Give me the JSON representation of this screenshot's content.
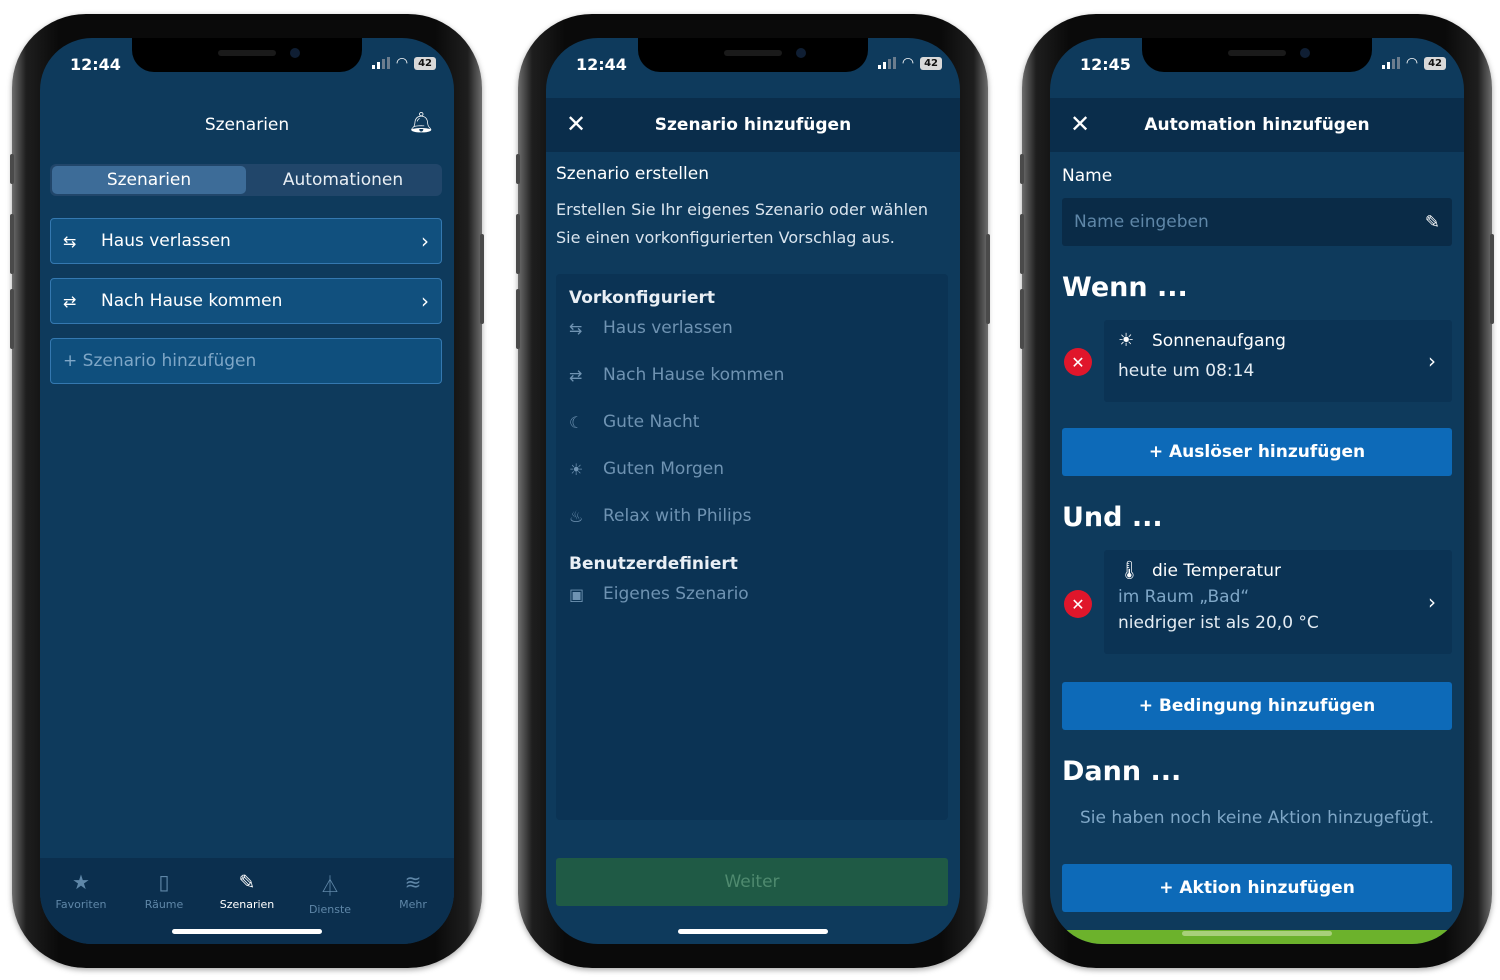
{
  "phone1": {
    "time": "12:44",
    "battery": "42",
    "title": "Szenarien",
    "segments": [
      "Szenarien",
      "Automationen"
    ],
    "rows": [
      {
        "label": "Haus verlassen",
        "icon": "leave-home-icon"
      },
      {
        "label": "Nach Hause kommen",
        "icon": "come-home-icon"
      }
    ],
    "add_label": "+ Szenario hinzufügen",
    "tabs": [
      {
        "label": "Favoriten",
        "icon": "star-icon"
      },
      {
        "label": "Räume",
        "icon": "door-icon"
      },
      {
        "label": "Szenarien",
        "icon": "magic-wand-icon"
      },
      {
        "label": "Dienste",
        "icon": "flask-icon"
      },
      {
        "label": "Mehr",
        "icon": "layers-icon"
      }
    ],
    "selected_tab": "Szenarien"
  },
  "phone2": {
    "time": "12:44",
    "battery": "42",
    "title": "Szenario hinzufügen",
    "subtitle": "Szenario erstellen",
    "description": "Erstellen Sie Ihr eigenes Szenario oder wählen Sie einen vorkonfigurierten Vorschlag aus.",
    "section_preconfigured": "Vorkonfiguriert",
    "preconfigured": [
      {
        "label": "Haus verlassen",
        "icon": "leave-home-icon"
      },
      {
        "label": "Nach Hause kommen",
        "icon": "come-home-icon"
      },
      {
        "label": "Gute Nacht",
        "icon": "moon-icon"
      },
      {
        "label": "Guten Morgen",
        "icon": "sunrise-icon"
      },
      {
        "label": "Relax with Philips",
        "icon": "relax-icon"
      }
    ],
    "section_custom": "Benutzerdefiniert",
    "custom": {
      "label": "Eigenes Szenario",
      "icon": "picture-icon"
    },
    "next_button": "Weiter"
  },
  "phone3": {
    "time": "12:45",
    "battery": "42",
    "title": "Automation hinzufügen",
    "name_label": "Name",
    "name_placeholder": "Name eingeben",
    "when_heading": "Wenn ...",
    "trigger": {
      "title": "Sonnenaufgang",
      "detail": "heute um 08:14",
      "icon": "sunrise-icon"
    },
    "add_trigger": "+ Auslöser hinzufügen",
    "and_heading": "Und ...",
    "condition": {
      "title": "die Temperatur",
      "room": "im Raum „Bad“",
      "detail": "niedriger ist als 20,0 °C",
      "icon": "thermometer-icon"
    },
    "add_condition": "+ Bedingung hinzufügen",
    "then_heading": "Dann ...",
    "empty_actions": "Sie haben noch keine Aktion hinzugefügt.",
    "add_action": "+ Aktion hinzufügen"
  },
  "colors": {
    "background": "#0e3a5c",
    "header": "#0a2d4b",
    "primary_button": "#0d6ab8",
    "remove": "#e0162b",
    "accent_green": "#6cb22c"
  }
}
